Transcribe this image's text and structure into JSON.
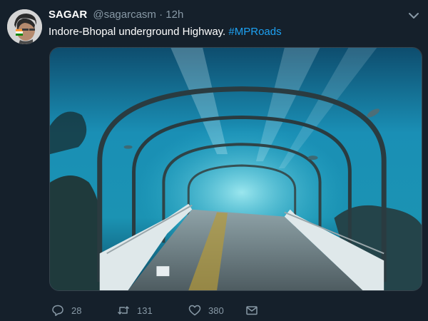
{
  "tweet": {
    "author_name": "SAGAR",
    "author_handle": "@sagarcasm",
    "separator": "·",
    "timestamp": "12h",
    "text": "Indore-Bhopal underground Highway. ",
    "hashtag": "#MPRoads",
    "media_icon": "photo-underwater-tunnel",
    "more_icon": "chevron-down-icon"
  },
  "actions": {
    "reply": {
      "icon": "reply-icon",
      "count": "28"
    },
    "retweet": {
      "icon": "retweet-icon",
      "count": "131"
    },
    "like": {
      "icon": "heart-icon",
      "count": "380"
    },
    "dm": {
      "icon": "envelope-icon"
    }
  },
  "colors": {
    "background": "#15202b",
    "secondary_text": "#8899a6",
    "link": "#1da1f2",
    "primary_text": "#ffffff"
  }
}
